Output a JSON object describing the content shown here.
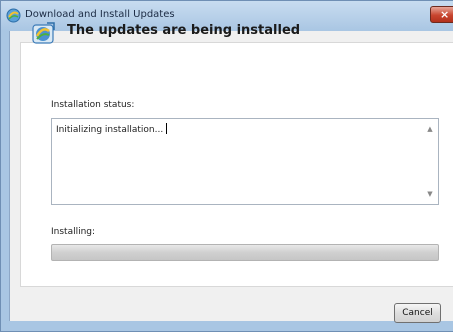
{
  "window": {
    "title": "Download and Install Updates",
    "close_symbol": "×"
  },
  "header": {
    "heading": "The updates are being installed",
    "icon": "update-installer-icon"
  },
  "status": {
    "label": "Installation status:",
    "text": "Initializing installation..."
  },
  "progress": {
    "label": "Installing:",
    "fraction": 0
  },
  "buttons": {
    "cancel_label": "Cancel"
  },
  "colors": {
    "title_bar": "#a9c6e3",
    "close_button": "#c8452e",
    "progress_fill": "#3cb33c"
  }
}
